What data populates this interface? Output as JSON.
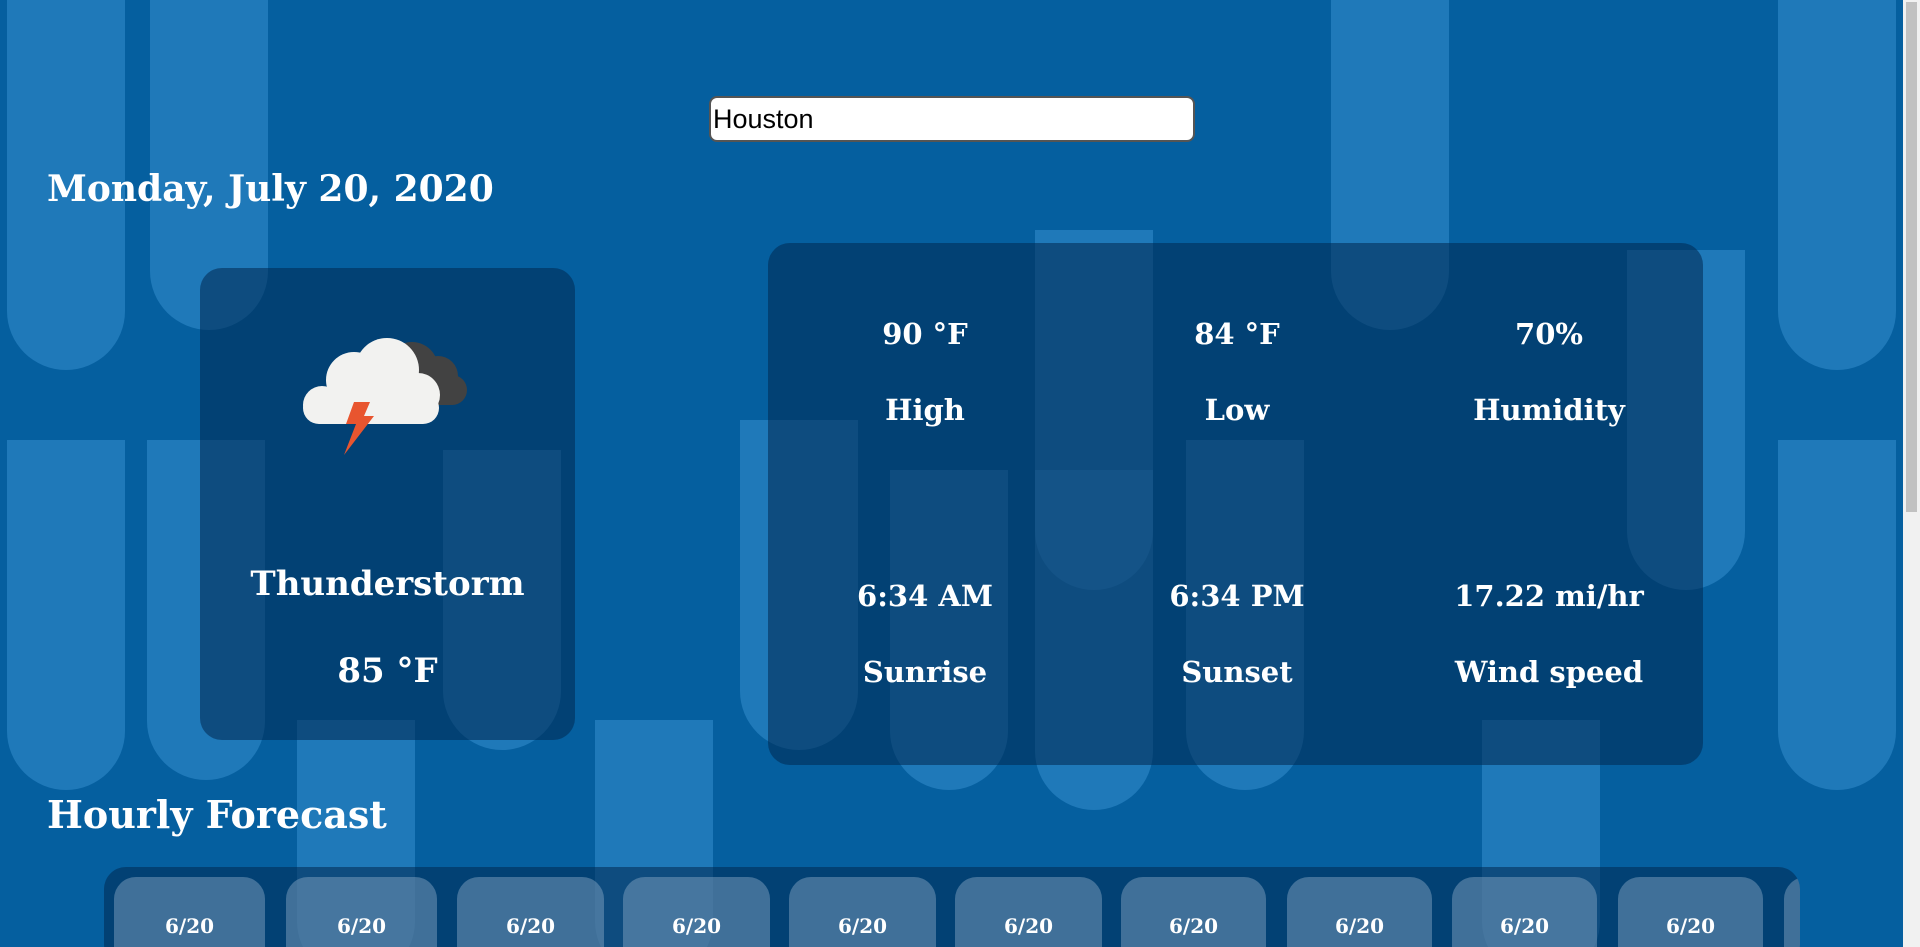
{
  "search": {
    "value": "Houston"
  },
  "date": "Monday, July 20, 2020",
  "current": {
    "icon": "thunderstorm-icon",
    "condition": "Thunderstorm",
    "temperature": "85 °F"
  },
  "details": {
    "high": {
      "value": "90 °F",
      "label": "High"
    },
    "low": {
      "value": "84 °F",
      "label": "Low"
    },
    "humidity": {
      "value": "70%",
      "label": "Humidity"
    },
    "sunrise": {
      "value": "6:34 AM",
      "label": "Sunrise"
    },
    "sunset": {
      "value": "6:34 PM",
      "label": "Sunset"
    },
    "wind": {
      "value": "17.22 mi/hr",
      "label": "Wind speed"
    }
  },
  "hourly": {
    "title": "Hourly Forecast",
    "items": [
      {
        "date": "6/20"
      },
      {
        "date": "6/20"
      },
      {
        "date": "6/20"
      },
      {
        "date": "6/20"
      },
      {
        "date": "6/20"
      },
      {
        "date": "6/20"
      },
      {
        "date": "6/20"
      },
      {
        "date": "6/20"
      },
      {
        "date": "6/20"
      },
      {
        "date": "6/20"
      }
    ]
  },
  "colors": {
    "background": "#055f9f",
    "card": "#013f6f",
    "rain": "#3b97d8",
    "lightning": "#e8552f"
  }
}
